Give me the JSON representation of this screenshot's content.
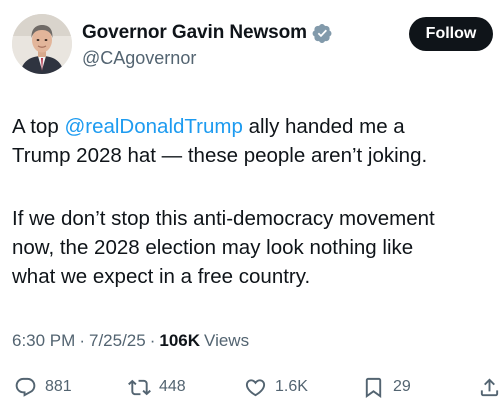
{
  "author": {
    "name": "Governor Gavin Newsom",
    "handle": "@CAgovernor",
    "avatar_icon": "profile-photo",
    "verified_icon": "verified-badge-icon",
    "verified_color": "#829aab"
  },
  "follow_button": {
    "label": "Follow",
    "bg": "#0f1419",
    "color": "#ffffff"
  },
  "body": {
    "line1_prefix": "A top ",
    "mention": "@realDonaldTrump",
    "line1_suffix": " ally handed me a",
    "line2": "Trump 2028 hat — these people aren’t joking.",
    "line3": "If we don’t stop this anti-democracy movement",
    "line4": "now, the 2028 election may look nothing like",
    "line5": "what we expect in a free country.",
    "mention_color": "#1d9bf0"
  },
  "meta": {
    "time": "6:30 PM",
    "separator": "·",
    "date": "7/25/25",
    "views_count": "106K",
    "views_label": "Views"
  },
  "actions": {
    "reply": {
      "icon": "reply-icon",
      "count": "881"
    },
    "repost": {
      "icon": "repost-icon",
      "count": "448"
    },
    "like": {
      "icon": "heart-icon",
      "count": "1.6K"
    },
    "bookmark": {
      "icon": "bookmark-icon",
      "count": "29"
    },
    "share": {
      "icon": "share-icon"
    }
  },
  "colors": {
    "text": "#0f1419",
    "secondary": "#536471",
    "accent": "#1d9bf0"
  }
}
